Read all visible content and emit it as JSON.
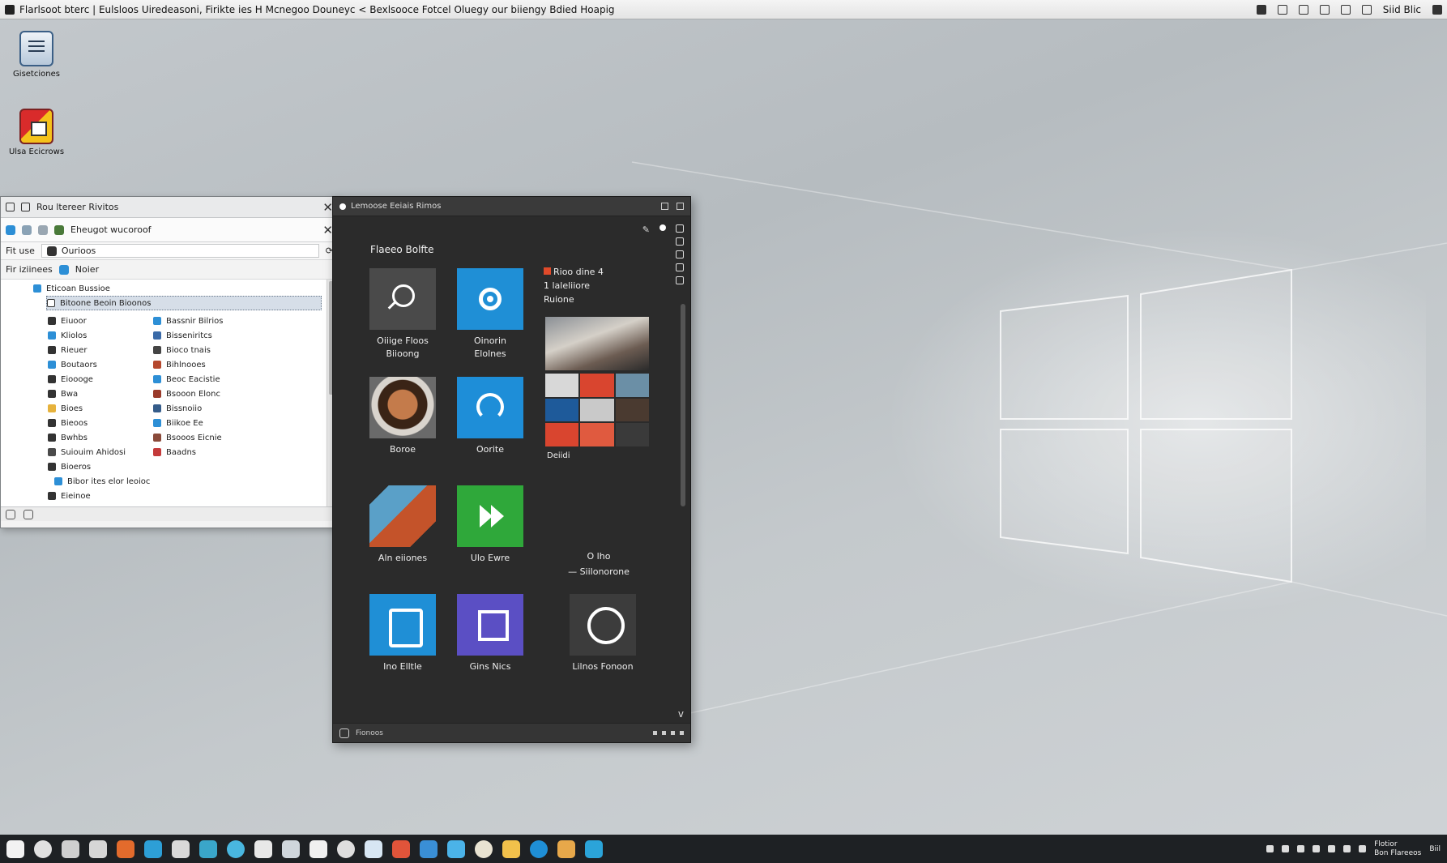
{
  "menubar": {
    "title": "Flarlsoot bterc | Eulsloos Uiredeasoni, Firikte ies H Mcnegoo Douneyc < Bexlsooce Fotcel Oluegy our biiengy Bdied Hoapig",
    "clock": "Siid Blic"
  },
  "desktop_icons": [
    {
      "label": "Gisetciones"
    },
    {
      "label": "Ulsa Ecicrows"
    }
  ],
  "explorer": {
    "title": "Rou ltereer Rivitos",
    "tab_label": "Eheugot wucoroof",
    "path_left": "Fit use",
    "path_box": "Ourioos",
    "crumb_left": "Fir iziinees",
    "crumb_right": "Noier",
    "tree_top": "Eticoan Bussioe",
    "tree_selected": "Bitoone Beoin Bioonos",
    "left_items": [
      "Eiuoor",
      "Kliolos",
      "Rieuer",
      "Boutaors",
      "Eioooge",
      "Bwa",
      "Bioes",
      "Bieoos",
      "Bwhbs",
      "Suiouim Ahidosi",
      "Bioeros",
      "Bibor ites elor leoioc",
      "Eieinoe"
    ],
    "right_items": [
      "Bassnir Bilrios",
      "Bisseniritcs",
      "Bioco tnais",
      "Bihlnooes",
      "Beoc Eacistie",
      "Bsooon Elonc",
      "Bissnoiio",
      "Biikoe Ee",
      "Bsooos Eicnie",
      "Baadns"
    ]
  },
  "panel": {
    "title": "Lemoose Eeiais Rimos",
    "heading": "Flaeeo Bolfte",
    "tiles": [
      {
        "label": "Oiiige Floos Biioong"
      },
      {
        "label": "Oinorin Elolnes"
      },
      {
        "label": "Boroe"
      },
      {
        "label": "Oorite"
      },
      {
        "label": "Aln eiiones"
      },
      {
        "label": "Ulo Ewre"
      },
      {
        "label": "Ino Elltle"
      },
      {
        "label": "Gins Nics"
      },
      {
        "label": "Lilnos Fonoon"
      }
    ],
    "side_text": [
      "Rioo dine 4",
      "1 laleliiore",
      "Ruione"
    ],
    "photo_label": "Deiidi",
    "clock_note": [
      "O lho",
      "— Siilonorone"
    ],
    "status": "Fionoos"
  },
  "taskbar": {
    "tray_line1": "Flotior",
    "tray_line2": "Bon Flareeos",
    "tray_right": "Biil"
  },
  "colors": {
    "tile_blue": "#1f8fd6",
    "tile_green": "#2fa83a",
    "tile_purple": "#5b4fc4",
    "panel_bg": "#2b2b2b",
    "taskbar_bg": "#1e2124"
  }
}
